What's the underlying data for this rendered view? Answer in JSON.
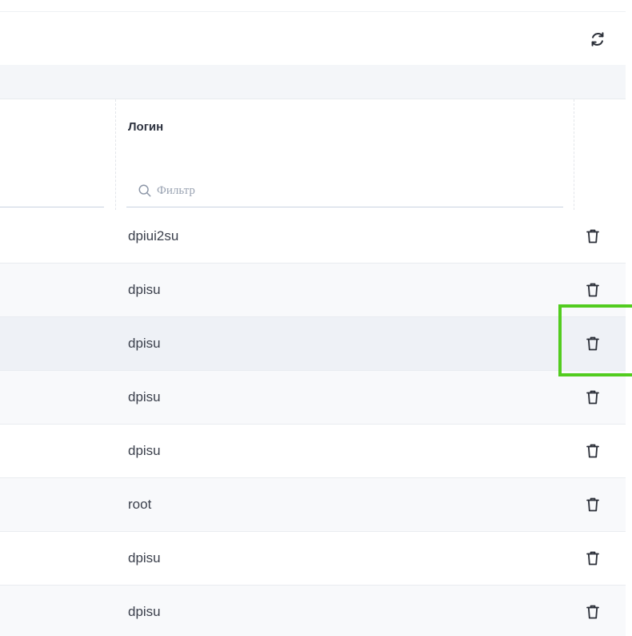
{
  "toolbar": {
    "refresh_icon": "refresh-icon"
  },
  "table": {
    "columns": [
      {
        "title": "Логин",
        "filter_placeholder": "Фильтр"
      }
    ],
    "rows": [
      {
        "login": "dpiui2su",
        "action_icon": "trash-icon"
      },
      {
        "login": "dpisu",
        "action_icon": "trash-icon"
      },
      {
        "login": "dpisu",
        "action_icon": "trash-icon"
      },
      {
        "login": "dpisu",
        "action_icon": "trash-icon"
      },
      {
        "login": "dpisu",
        "action_icon": "trash-icon"
      },
      {
        "login": "root",
        "action_icon": "trash-icon"
      },
      {
        "login": "dpisu",
        "action_icon": "trash-icon"
      },
      {
        "login": "dpisu",
        "action_icon": "trash-icon"
      }
    ]
  },
  "highlight": {
    "target": "row 3 delete button",
    "color": "#52cc1f"
  }
}
